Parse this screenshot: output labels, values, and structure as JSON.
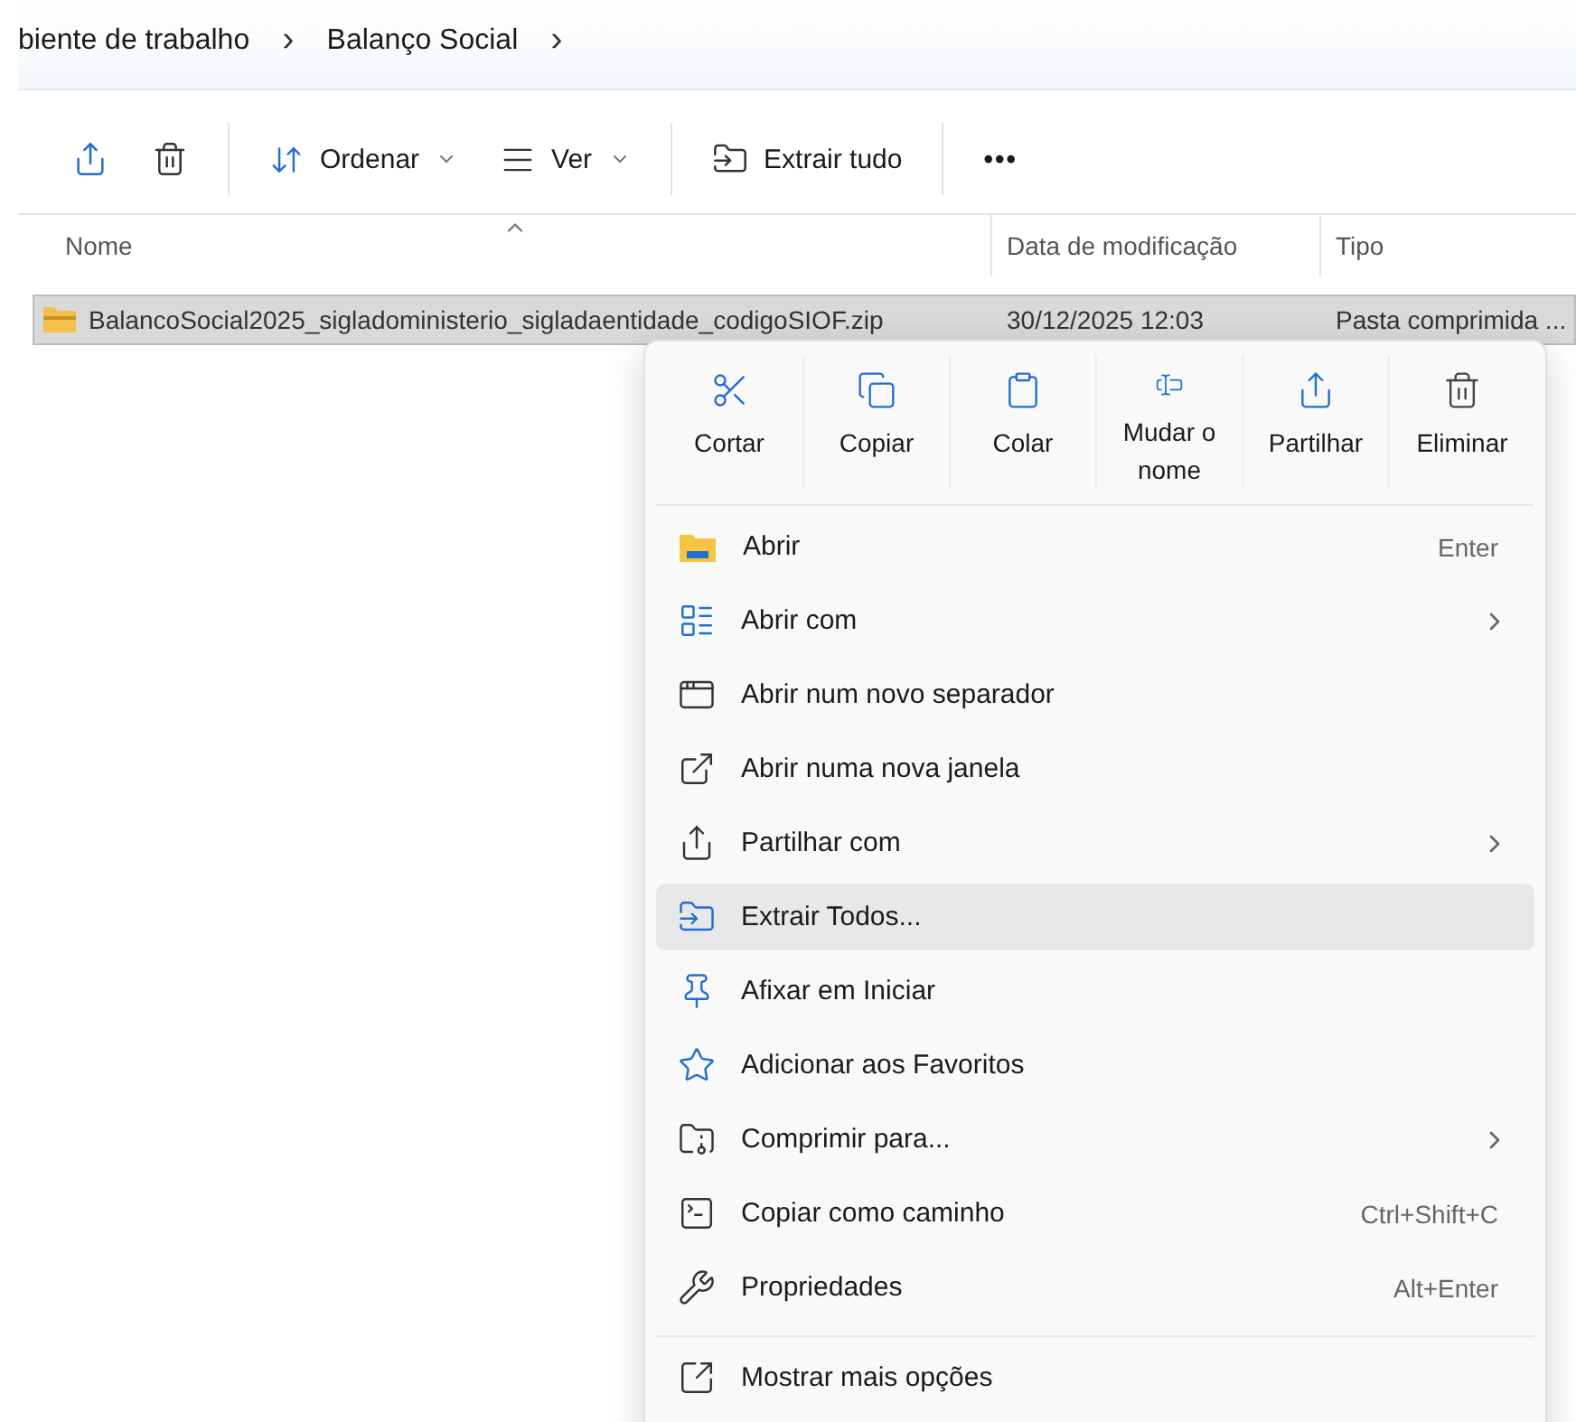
{
  "breadcrumb": {
    "items": [
      {
        "label": "biente de trabalho",
        "separator": "›"
      },
      {
        "label": "Balanço Social",
        "separator": "›"
      }
    ]
  },
  "toolbar": {
    "buttons": [
      {
        "kind": "icon"
      },
      {
        "kind": "icon"
      },
      {
        "kind": "divider"
      },
      {
        "kind": "dropdown",
        "label": "Ordenar"
      },
      {
        "kind": "dropdown",
        "label": "Ver"
      },
      {
        "kind": "divider"
      },
      {
        "kind": "text",
        "label": "Extrair tudo"
      },
      {
        "kind": "divider"
      },
      {
        "kind": "more",
        "label": "•••"
      }
    ]
  },
  "table": {
    "columns": [
      "Nome",
      "Data de modificação",
      "Tipo"
    ],
    "rows": [
      {
        "name": "BalancoSocial2025_sigladoministerio_sigladaentidade_codigoSIOF.zip",
        "modified": "30/12/2025 12:03",
        "type": "Pasta comprimida ...",
        "selected": true
      }
    ]
  },
  "context_menu": {
    "actions": [
      {
        "label": "Cortar"
      },
      {
        "label": "Copiar"
      },
      {
        "label": "Colar"
      },
      {
        "label": "Mudar o nome"
      },
      {
        "label": "Partilhar"
      },
      {
        "label": "Eliminar"
      }
    ],
    "items": [
      {
        "label": "Abrir",
        "shortcut": "Enter",
        "submenu": false,
        "selected": false
      },
      {
        "label": "Abrir com",
        "submenu": true,
        "selected": false
      },
      {
        "label": "Abrir num novo separador",
        "submenu": false,
        "selected": false
      },
      {
        "label": "Abrir numa nova janela",
        "submenu": false,
        "selected": false
      },
      {
        "label": "Partilhar com",
        "submenu": true,
        "selected": false
      },
      {
        "label": "Extrair Todos...",
        "submenu": false,
        "selected": true
      },
      {
        "label": "Afixar em Iniciar",
        "submenu": false,
        "selected": false
      },
      {
        "label": "Adicionar aos Favoritos",
        "submenu": false,
        "selected": false
      },
      {
        "label": "Comprimir para...",
        "submenu": true,
        "selected": false
      },
      {
        "label": "Copiar como caminho",
        "shortcut": "Ctrl+Shift+C",
        "submenu": false,
        "selected": false
      },
      {
        "label": "Propriedades",
        "shortcut": "Alt+Enter",
        "submenu": false,
        "selected": false
      }
    ],
    "footer": {
      "label": "Mostrar mais opções"
    }
  }
}
